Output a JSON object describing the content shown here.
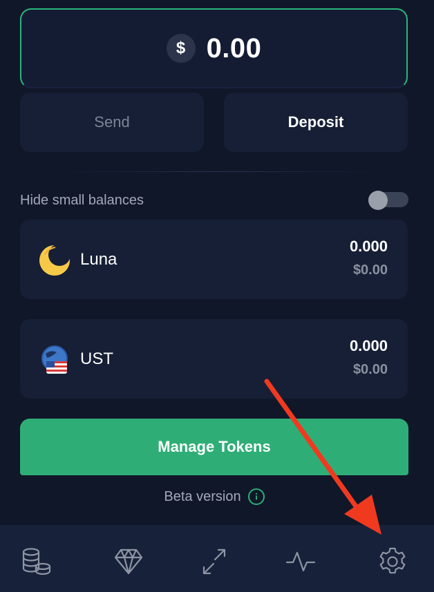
{
  "balance": {
    "currency_symbol": "$",
    "amount": "0.00"
  },
  "actions": {
    "send_label": "Send",
    "deposit_label": "Deposit"
  },
  "filter": {
    "hide_small_label": "Hide small balances",
    "hide_small_enabled": false
  },
  "tokens": [
    {
      "name": "Luna",
      "amount": "0.000",
      "value": "$0.00",
      "icon": "luna-moon-icon"
    },
    {
      "name": "UST",
      "amount": "0.000",
      "value": "$0.00",
      "icon": "ust-flag-globe-icon"
    }
  ],
  "manage_tokens_label": "Manage Tokens",
  "beta": {
    "label": "Beta version",
    "icon": "info-icon"
  },
  "nav": [
    {
      "name": "coins-stack-icon"
    },
    {
      "name": "diamond-icon"
    },
    {
      "name": "swap-arrows-icon"
    },
    {
      "name": "activity-pulse-icon"
    },
    {
      "name": "gear-icon"
    }
  ],
  "colors": {
    "background": "#101729",
    "card": "#161f35",
    "accent_green": "#2eae76",
    "arrow_red": "#f03a20"
  }
}
